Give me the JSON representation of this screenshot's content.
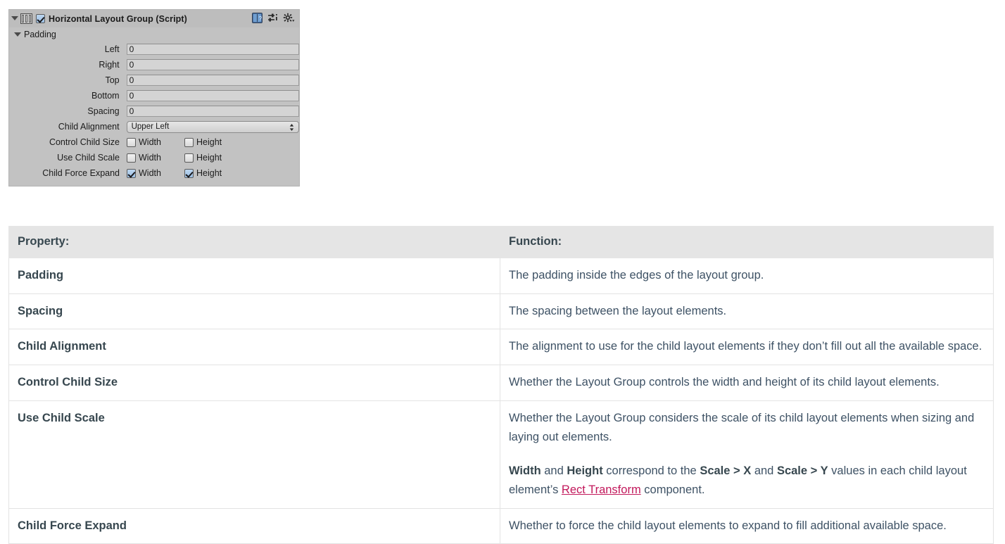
{
  "inspector": {
    "title": "Horizontal Layout Group (Script)",
    "enabled_checkbox": "component-enabled",
    "icons": {
      "foldout": "triangle-down-icon",
      "component": "horizontal-layout-group-icon",
      "help": "help-book-icon",
      "preset": "preset-sliders-icon",
      "settings": "gear-dropdown-icon"
    },
    "padding_group_label": "Padding",
    "padding_fields": [
      {
        "label": "Left",
        "value": "0"
      },
      {
        "label": "Right",
        "value": "0"
      },
      {
        "label": "Top",
        "value": "0"
      },
      {
        "label": "Bottom",
        "value": "0"
      }
    ],
    "spacing": {
      "label": "Spacing",
      "value": "0"
    },
    "child_alignment": {
      "label": "Child Alignment",
      "value": "Upper Left"
    },
    "toggle_rows": [
      {
        "label": "Control Child Size",
        "width_label": "Width",
        "width_checked": false,
        "height_label": "Height",
        "height_checked": false
      },
      {
        "label": "Use Child Scale",
        "width_label": "Width",
        "width_checked": false,
        "height_label": "Height",
        "height_checked": false
      },
      {
        "label": "Child Force Expand",
        "width_label": "Width",
        "width_checked": true,
        "height_label": "Height",
        "height_checked": true
      }
    ]
  },
  "table": {
    "headers": {
      "property": "Property:",
      "function": "Function:"
    },
    "rows": [
      {
        "property": "Padding",
        "function": "The padding inside the edges of the layout group."
      },
      {
        "property": "Spacing",
        "function": "The spacing between the layout elements."
      },
      {
        "property": "Child Alignment",
        "function": "The alignment to use for the child layout elements if they don’t fill out all the available space."
      },
      {
        "property": "Control Child Size",
        "function": "Whether the Layout Group controls the width and height of its child layout elements."
      },
      {
        "property": "Use Child Scale",
        "function_p1": "Whether the Layout Group considers the scale of its child layout elements when sizing and laying out elements.",
        "function_p2_pre": "",
        "function_p2_b1": "Width",
        "function_p2_mid1": " and ",
        "function_p2_b2": "Height",
        "function_p2_mid2": " correspond to the ",
        "function_p2_b3": "Scale > X",
        "function_p2_mid3": " and ",
        "function_p2_b4": "Scale > Y",
        "function_p2_mid4": " values in each child layout element’s ",
        "function_p2_link": "Rect Transform",
        "function_p2_post": " component."
      },
      {
        "property": "Child Force Expand",
        "function": "Whether to force the child layout elements to expand to fill additional available space."
      }
    ]
  },
  "colors": {
    "link": "#c2185b",
    "table_header_bg": "#e5e5e5",
    "text": "#3e5265",
    "inspector_bg": "#c2c2c2"
  }
}
